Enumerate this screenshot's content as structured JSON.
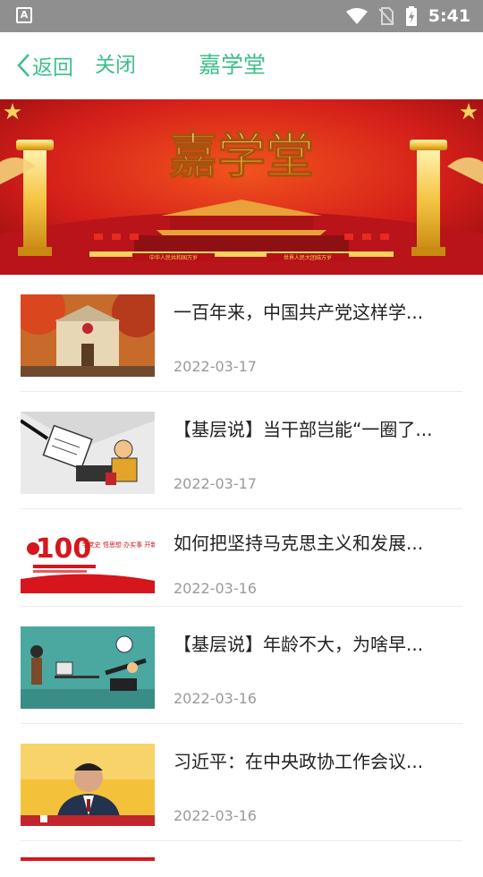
{
  "status_bar": {
    "left_icon": "A",
    "time": "5:41",
    "icons": [
      "wifi-icon",
      "no-sim-icon",
      "battery-charging-icon"
    ]
  },
  "nav": {
    "back_label": "返回",
    "close_label": "关闭",
    "title": "嘉学堂"
  },
  "banner": {
    "title": "嘉学堂",
    "left_slogan": "中华人民共和国万岁",
    "right_slogan": "世界人民大团结万岁"
  },
  "articles": [
    {
      "title": "一百年来，中国共产党这样学...",
      "date": "2022-03-17",
      "thumb": "red-building-autumn-image"
    },
    {
      "title": "【基层说】当干部岂能“一圈了...",
      "date": "2022-03-17",
      "thumb": "cartoon-official-document-image"
    },
    {
      "title": "如何把坚持马克思主义和发展...",
      "date": "2022-03-16",
      "thumb": "party-100-years-image",
      "thumb_text": "100",
      "thumb_slogan": "学党史 悟思想 办实事 开新局"
    },
    {
      "title": "【基层说】年龄不大，为啥早...",
      "date": "2022-03-16",
      "thumb": "cartoon-lazy-worker-image"
    },
    {
      "title": "习近平：在中央政协工作会议...",
      "date": "2022-03-16",
      "thumb": "speaker-portrait-image"
    }
  ],
  "colors": {
    "accent": "#3dbf8a",
    "statusbar": "#8f8f8f",
    "banner_red": "#c8161d",
    "gold": "#f7d35c"
  }
}
